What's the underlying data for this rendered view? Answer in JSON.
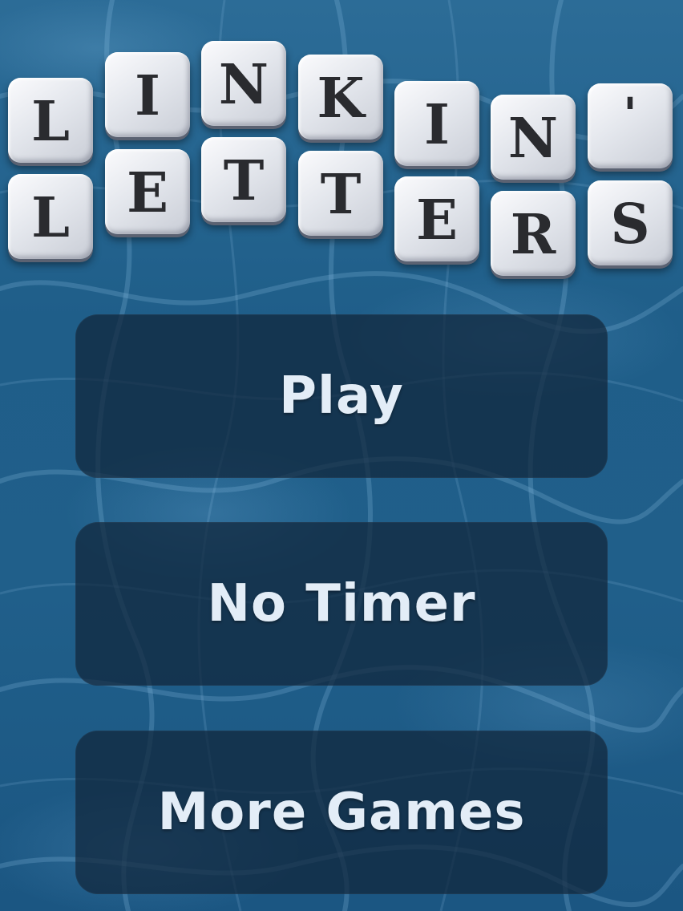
{
  "title": {
    "word1": [
      "L",
      "I",
      "N",
      "K",
      "I",
      "N",
      "'"
    ],
    "word2": [
      "L",
      "E",
      "T",
      "T",
      "E",
      "R",
      "S"
    ]
  },
  "menu": {
    "play_label": "Play",
    "no_timer_label": "No Timer",
    "more_games_label": "More Games"
  },
  "colors": {
    "background": "#205f8a",
    "tile": "#e4e7ed",
    "tile_letter": "#2a2b2f",
    "button": "#10263a",
    "button_text": "#e3edf7"
  }
}
